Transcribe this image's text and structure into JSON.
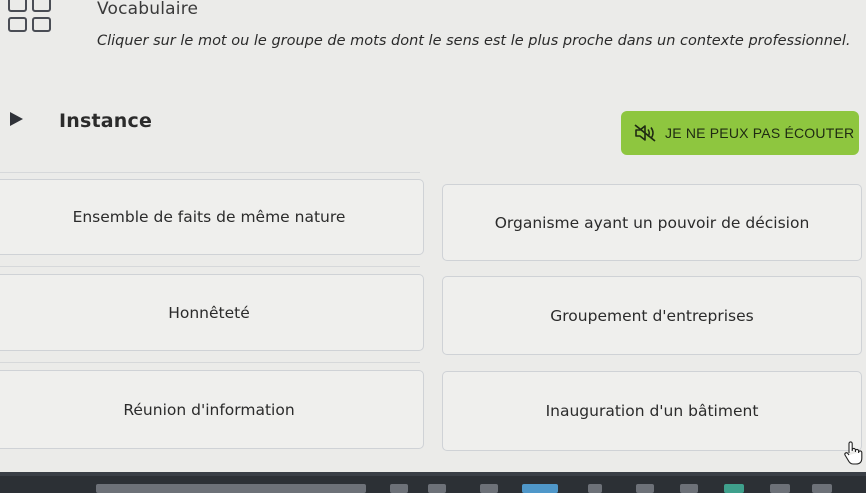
{
  "header": {
    "app_title": "Vocabulaire",
    "instruction": "Cliquer sur le mot ou le groupe de mots dont le sens est le plus proche dans un contexte professionnel."
  },
  "question": {
    "word": "Instance",
    "listen_button_label": "JE NE PEUX PAS ÉCOUTER"
  },
  "choices": [
    {
      "label": "Ensemble de faits de même nature"
    },
    {
      "label": "Organisme ayant un pouvoir de décision"
    },
    {
      "label": "Honnêteté"
    },
    {
      "label": "Groupement d'entreprises"
    },
    {
      "label": "Réunion d'information"
    },
    {
      "label": "Inauguration d'un bâtiment"
    }
  ],
  "icons": {
    "header": "grid-icon",
    "play": "play-icon",
    "mute": "speaker-muted-icon",
    "cursor": "hand-cursor-icon"
  },
  "colors": {
    "background": "#ebebe9",
    "accent_green": "#8ec63f",
    "taskbar": "#2c3035"
  }
}
